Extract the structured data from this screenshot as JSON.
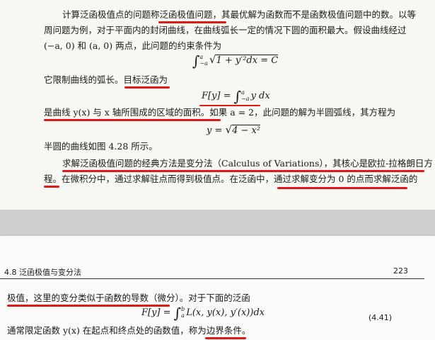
{
  "top": {
    "line1": "计算泛函极值点的问题称泛函极值问题，其最优解为函数而不是函数极值问题中的数。以等",
    "line2": "周问题为例，对于平面内的封闭曲线，在曲线弧长一定的情况下圆的面积最大。假设曲线经过",
    "line3": "(−a, 0) 和 (a, 0) 两点，此问题的约束条件为",
    "eq1_lower": "−a",
    "eq1_upper": "a",
    "eq1_body": "1 + y′²dx = C",
    "line4": "它限制曲线的弧长。目标泛函为",
    "eq2_lhs": "F[y] = ",
    "eq2_lower": "−a",
    "eq2_upper": "a",
    "eq2_body": "y dx",
    "line5": "是曲线 y(x) 与 x 轴所围成的区域的面积。如果 a = 2，此问题的解为半圆弧线，其方程为",
    "eq3_lhs": "y = ",
    "eq3_body": "4 − x²",
    "line6": "半圆的曲线如图 4.28 所示。",
    "line7": "求解泛函极值问题的经典方法是变分法（Calculus of Variations），其核心是欧拉-拉格朗日方",
    "line8": "程。在微积分中，通过求解驻点而得到极值点。在泛函中，通过求解变分为 0 的点而求解泛函的"
  },
  "bottom": {
    "section_title": "4.8  泛函极值与变分法",
    "page_number": "223",
    "line1": "极值，这里的变分类似于函数的导数（微分）。对于下面的泛函",
    "eq_lhs": "F[y] = ",
    "eq_lower": "a",
    "eq_upper": "b",
    "eq_body": "L(x, y(x), y′(x))dx",
    "eq_number": "(4.41)",
    "line2": "通常限定函数 y(x) 在起点和终点处的函数值，称为边界条件。"
  },
  "colors": {
    "annotation": "#e01818",
    "paper": "#f7f7f3",
    "ink": "#1a1a1a"
  }
}
